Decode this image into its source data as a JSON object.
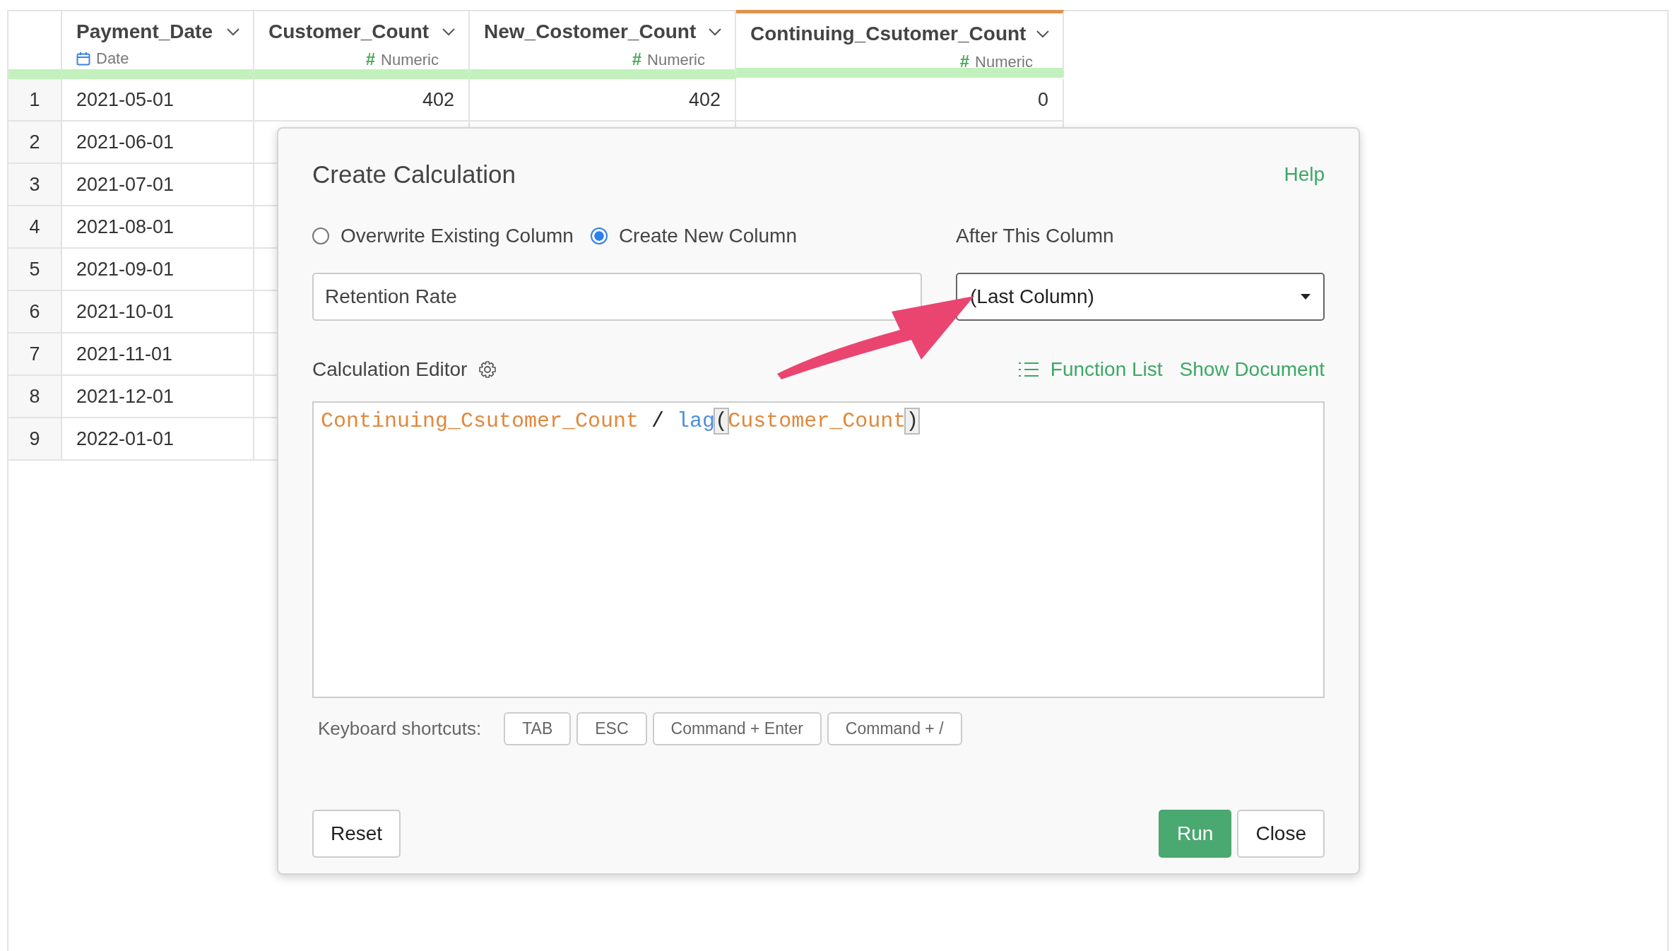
{
  "table": {
    "columns": [
      {
        "name": "Payment_Date",
        "kind": "date",
        "type_label": "Date",
        "selected": false
      },
      {
        "name": "Customer_Count",
        "kind": "numeric",
        "type_symbol": "#",
        "type_label": "Numeric",
        "selected": false
      },
      {
        "name": "New_Costomer_Count",
        "kind": "numeric",
        "type_symbol": "#",
        "type_label": "Numeric",
        "selected": false
      },
      {
        "name": "Continuing_Csutomer_Count",
        "kind": "numeric",
        "type_symbol": "#",
        "type_label": "Numeric",
        "selected": true
      }
    ],
    "rows": [
      {
        "index": "1",
        "cells": [
          "2021-05-01",
          "402",
          "402",
          "0"
        ]
      },
      {
        "index": "2",
        "cells": [
          "2021-06-01"
        ]
      },
      {
        "index": "3",
        "cells": [
          "2021-07-01"
        ]
      },
      {
        "index": "4",
        "cells": [
          "2021-08-01"
        ]
      },
      {
        "index": "5",
        "cells": [
          "2021-09-01"
        ]
      },
      {
        "index": "6",
        "cells": [
          "2021-10-01"
        ]
      },
      {
        "index": "7",
        "cells": [
          "2021-11-01"
        ]
      },
      {
        "index": "8",
        "cells": [
          "2021-12-01"
        ]
      },
      {
        "index": "9",
        "cells": [
          "2022-01-01"
        ]
      }
    ]
  },
  "dialog": {
    "title": "Create Calculation",
    "help": "Help",
    "modes": [
      {
        "label": "Overwrite Existing Column",
        "selected": false
      },
      {
        "label": "Create New Column",
        "selected": true
      }
    ],
    "column_name": {
      "value": "Retention Rate"
    },
    "after_column": {
      "label": "After This Column",
      "value": "(Last Column)"
    },
    "editor": {
      "label": "Calculation Editor",
      "links": [
        "Function List",
        "Show Document"
      ],
      "tokens": [
        {
          "text": "Continuing_Csutomer_Count",
          "kind": "column"
        },
        {
          "text": " / ",
          "kind": "operator"
        },
        {
          "text": "lag",
          "kind": "function"
        },
        {
          "text": "(",
          "kind": "paren",
          "matched": true
        },
        {
          "text": "Customer_Count",
          "kind": "column"
        },
        {
          "text": ")",
          "kind": "paren",
          "matched": true
        }
      ]
    },
    "shortcuts": {
      "label": "Keyboard shortcuts:",
      "keys": [
        "TAB",
        "ESC",
        "Command + Enter",
        "Command + /"
      ]
    },
    "buttons": {
      "reset": "Reset",
      "run": "Run",
      "close": "Close"
    }
  }
}
